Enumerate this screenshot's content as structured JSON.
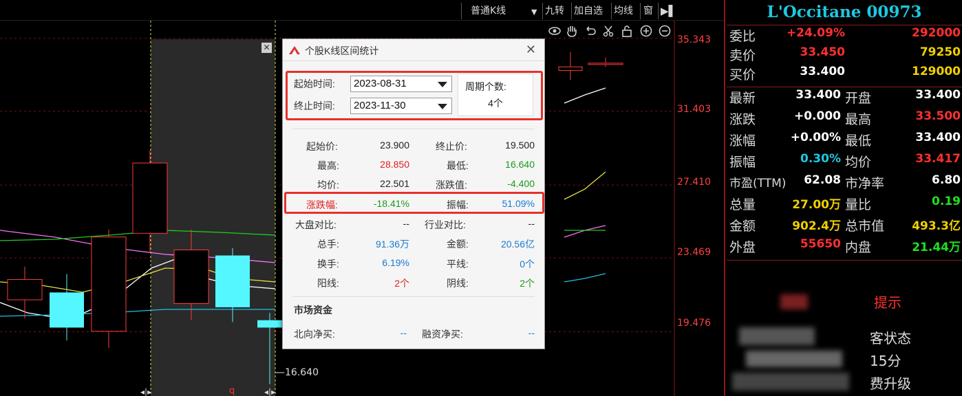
{
  "toolbar": {
    "kline_type": "普通K线",
    "btn_jiuzhuan": "九转",
    "btn_add_watch": "加自选",
    "btn_ma": "均线",
    "btn_window": "窗"
  },
  "axis": {
    "ticks": [
      "35.343",
      "31.403",
      "27.410",
      "23.469",
      "19.476"
    ],
    "low_marker": "16.640"
  },
  "chart_data": {
    "type": "candlestick",
    "candles": [
      {
        "open": 22.3,
        "close": 21.2,
        "high": 23.0,
        "low": 20.2,
        "dir": "up"
      },
      {
        "open": 21.6,
        "close": 19.7,
        "high": 22.6,
        "low": 19.0,
        "dir": "down"
      },
      {
        "open": 24.6,
        "close": 19.5,
        "high": 25.0,
        "low": 18.6,
        "dir": "up"
      },
      {
        "open": 24.8,
        "close": 28.6,
        "high": 29.3,
        "low": 23.8,
        "dir": "up"
      },
      {
        "open": 21.0,
        "close": 23.9,
        "high": 25.0,
        "low": 20.1,
        "dir": "up"
      },
      {
        "open": 23.6,
        "close": 20.8,
        "high": 24.0,
        "low": 20.0,
        "dir": "down"
      },
      {
        "open": 20.1,
        "close": 19.7,
        "high": 20.5,
        "low": 16.64,
        "dir": "down"
      },
      {
        "open": 33.6,
        "close": 33.8,
        "high": 34.6,
        "low": 33.1,
        "dir": "up"
      },
      {
        "open": 34.0,
        "close": 34.0,
        "high": 34.3,
        "low": 33.8,
        "dir": "up"
      }
    ],
    "y_range": [
      16.0,
      36.3
    ]
  },
  "info": {
    "title": "L'Occitane 00973",
    "rows": [
      {
        "l": "委比",
        "v1": "+24.09%",
        "v1c": "#ff3030",
        "v2": "292000",
        "v2c": "#ff3030"
      },
      {
        "l": "卖价",
        "v1": "33.450",
        "v1c": "#ff3030",
        "v2": "79250",
        "v2c": "#f0d000"
      },
      {
        "l": "买价",
        "v1": "33.400",
        "v1c": "#ffffff",
        "v2": "129000",
        "v2c": "#f0d000"
      },
      {
        "l": "最新",
        "v1": "33.400",
        "v1c": "#ffffff",
        "l2": "开盘",
        "v2": "33.400",
        "v2c": "#ffffff"
      },
      {
        "l": "涨跌",
        "v1": "+0.000",
        "v1c": "#ffffff",
        "l2": "最高",
        "v2": "33.500",
        "v2c": "#ff3030"
      },
      {
        "l": "涨幅",
        "v1": "+0.00%",
        "v1c": "#ffffff",
        "l2": "最低",
        "v2": "33.400",
        "v2c": "#ffffff"
      },
      {
        "l": "振幅",
        "v1": "0.30%",
        "v1c": "#1ec8e0",
        "l2": "均价",
        "v2": "33.417",
        "v2c": "#ff3030"
      },
      {
        "l": "市盈(TTM)",
        "v1": "62.08",
        "v1c": "#ffffff",
        "l2": "市净率",
        "v2": "6.80",
        "v2c": "#ffffff"
      },
      {
        "l": "总量",
        "v1": "27.00万",
        "v1c": "#f0d000",
        "l2": "量比",
        "v2": "0.19",
        "v2c": "#20e020"
      },
      {
        "l": "金额",
        "v1": "902.4万",
        "v1c": "#f0d000",
        "l2": "总市值",
        "v2": "493.3亿",
        "v2c": "#f0d000"
      },
      {
        "l": "外盘",
        "v1": "55650",
        "v1c": "#ff3030",
        "l2": "内盘",
        "v2": "21.44万",
        "v2c": "#20e020"
      }
    ],
    "fragments": [
      "提示",
      "客状态",
      "15分",
      "费升级"
    ]
  },
  "dialog": {
    "title": "个股K线区间统计",
    "start_label": "起始时间:",
    "start_value": "2023-08-31",
    "end_label": "终止时间:",
    "end_value": "2023-11-30",
    "period_label": "周期个数:",
    "period_value": "4个",
    "stats": {
      "start_price_l": "起始价:",
      "start_price": "23.900",
      "end_price_l": "终止价:",
      "end_price": "19.500",
      "high_l": "最高:",
      "high": "28.850",
      "low_l": "最低:",
      "low": "16.640",
      "avg_l": "均价:",
      "avg": "22.501",
      "chg_l": "涨跌值:",
      "chg": "-4.400",
      "pct_l": "涨跌幅:",
      "pct": "-18.41%",
      "amp_l": "振幅:",
      "amp": "51.09%",
      "mkt_l": "大盘对比:",
      "mkt": "--",
      "ind_l": "行业对比:",
      "ind": "--",
      "vol_l": "总手:",
      "vol": "91.36万",
      "amt_l": "金额:",
      "amt": "20.56亿",
      "turn_l": "换手:",
      "turn": "6.19%",
      "flat_l": "平线:",
      "flat": "0个",
      "yang_l": "阳线:",
      "yang": "2个",
      "yin_l": "阴线:",
      "yin": "2个"
    },
    "fund_title": "市场资金",
    "north_l": "北向净买:",
    "north": "--",
    "margin_l": "融资净买:",
    "margin": "--"
  }
}
